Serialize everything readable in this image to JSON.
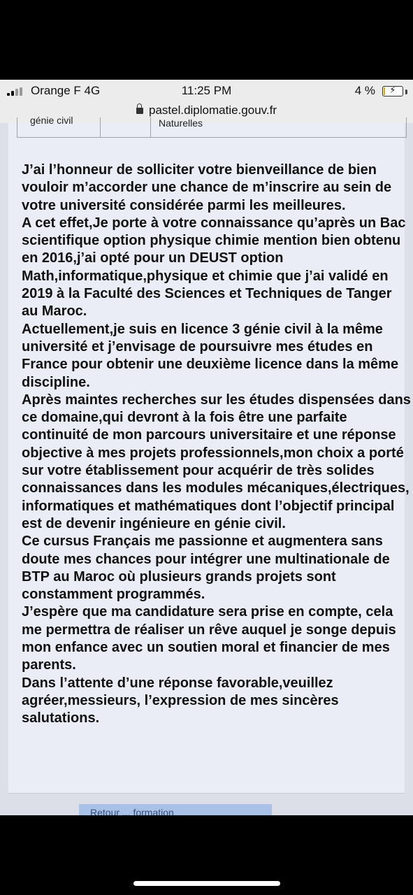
{
  "status_bar": {
    "carrier": "Orange F 4G",
    "time": "11:25 PM",
    "battery_percent": "4 %",
    "url": "pastel.diplomatie.gouv.fr"
  },
  "table_fragment": {
    "left_cell": "génie civil",
    "right_cell": "Naturelles"
  },
  "letter_paragraphs": [
    "J’ai l’honneur de solliciter votre bienveillance de bien vouloir m’accorder une chance de m’inscrire au sein de votre université considérée parmi les meilleures.",
    "A cet effet,Je porte à votre connaissance qu’après un Bac scientifique option physique chimie mention bien obtenu en 2016,j’ai opté pour un DEUST option Math,informatique,physique et chimie que j’ai validé en 2019 à la Faculté des Sciences et Techniques de Tanger au Maroc.",
    "Actuellement,je suis en licence 3 génie civil à la même université et j’envisage de poursuivre mes études en France pour obtenir une deuxième licence dans la même discipline.",
    "Après maintes recherches sur les études dispensées dans ce domaine,qui devront à la fois être une parfaite continuité de mon parcours universitaire et une réponse objective à mes projets professionnels,mon choix a porté sur votre établissement pour acquérir de très solides connaissances dans les modules mécaniques,électriques, informatiques et mathématiques dont l’objectif principal est de devenir ingénieure en génie civil.",
    "Ce cursus Français me passionne et augmentera sans doute mes chances pour intégrer une multinationale de BTP au Maroc où plusieurs grands projets sont constamment programmés.",
    "J’espère que ma candidature sera prise en compte, cela me permettra de réaliser un rêve auquel je songe depuis mon enfance avec un soutien moral et financier de mes parents.",
    "Dans l’attente d’une réponse favorable,veuillez agréer,messieurs, l’expression de mes sincères salutations."
  ],
  "button_partial_label": "Retour ... formation",
  "colors": {
    "page_bg": "#dcdfe8",
    "panel_bg": "#eaedf5",
    "button_bg": "#a9c1e6",
    "status_bar_bg": "#ececec"
  },
  "icons": [
    "signal-icon",
    "lock-icon",
    "battery-charging-icon"
  ]
}
